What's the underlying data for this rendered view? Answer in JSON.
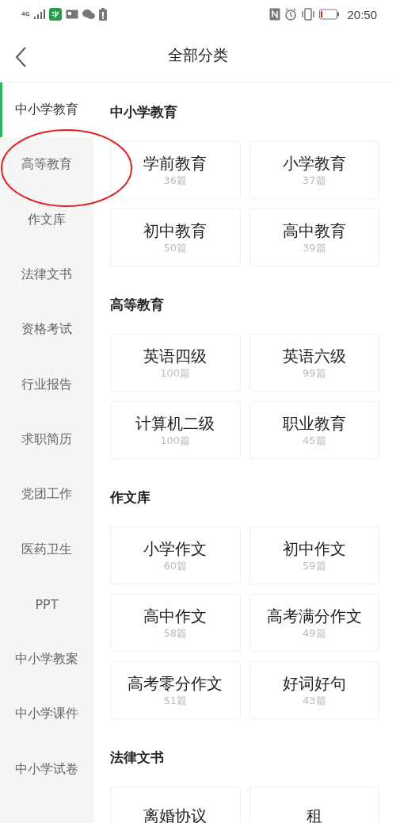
{
  "status_bar": {
    "time": "20:50",
    "network": "4G"
  },
  "header": {
    "title": "全部分类"
  },
  "sidebar": {
    "items": [
      {
        "label": "中小学教育",
        "selected": true
      },
      {
        "label": "高等教育",
        "selected": false
      },
      {
        "label": "作文库",
        "selected": false
      },
      {
        "label": "法律文书",
        "selected": false
      },
      {
        "label": "资格考试",
        "selected": false
      },
      {
        "label": "行业报告",
        "selected": false
      },
      {
        "label": "求职简历",
        "selected": false
      },
      {
        "label": "党团工作",
        "selected": false
      },
      {
        "label": "医药卫生",
        "selected": false
      },
      {
        "label": "PPT",
        "selected": false
      },
      {
        "label": "中小学教案",
        "selected": false
      },
      {
        "label": "中小学课件",
        "selected": false
      },
      {
        "label": "中小学试卷",
        "selected": false
      }
    ]
  },
  "sections": [
    {
      "title": "中小学教育",
      "cards": [
        {
          "name": "学前教育",
          "count": "36篇"
        },
        {
          "name": "小学教育",
          "count": "37篇"
        },
        {
          "name": "初中教育",
          "count": "50篇"
        },
        {
          "name": "高中教育",
          "count": "39篇"
        }
      ]
    },
    {
      "title": "高等教育",
      "cards": [
        {
          "name": "英语四级",
          "count": "100篇"
        },
        {
          "name": "英语六级",
          "count": "99篇"
        },
        {
          "name": "计算机二级",
          "count": "100篇"
        },
        {
          "name": "职业教育",
          "count": "45篇"
        }
      ]
    },
    {
      "title": "作文库",
      "cards": [
        {
          "name": "小学作文",
          "count": "60篇"
        },
        {
          "name": "初中作文",
          "count": "59篇"
        },
        {
          "name": "高中作文",
          "count": "58篇"
        },
        {
          "name": "高考满分作文",
          "count": "49篇"
        },
        {
          "name": "高考零分作文",
          "count": "51篇"
        },
        {
          "name": "好词好句",
          "count": "43篇"
        }
      ]
    },
    {
      "title": "法律文书",
      "cards": [
        {
          "name": "离婚协议"
        },
        {
          "name": "租"
        }
      ]
    }
  ]
}
